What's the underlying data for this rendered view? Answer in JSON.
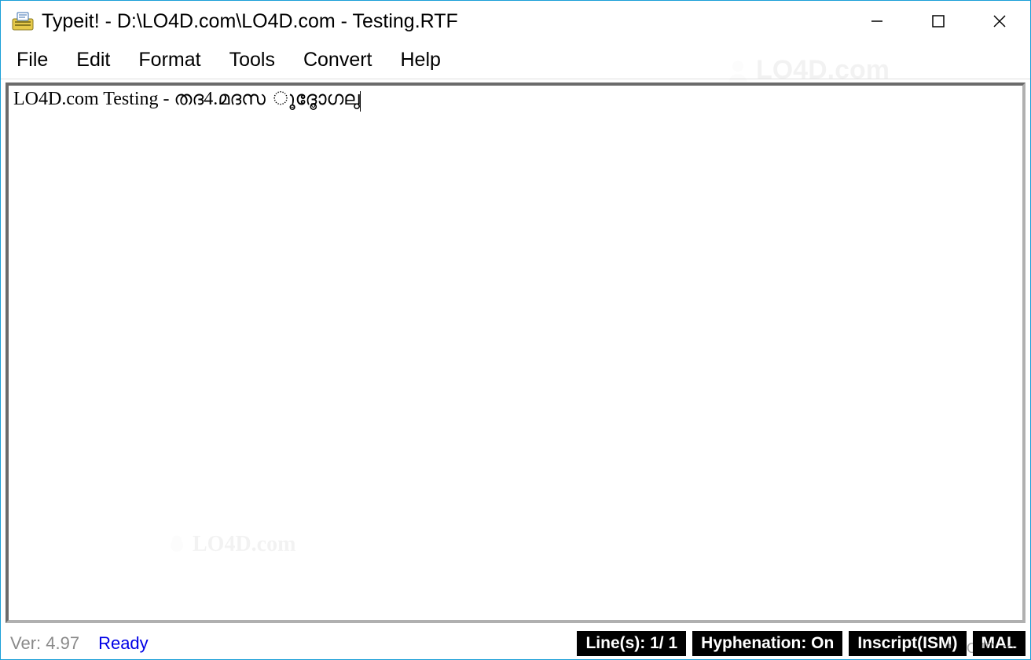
{
  "window": {
    "title": "Typeit! - D:\\LO4D.com\\LO4D.com - Testing.RTF"
  },
  "menu": {
    "items": [
      "File",
      "Edit",
      "Format",
      "Tools",
      "Convert",
      "Help"
    ]
  },
  "editor": {
    "content": "LO4D.com Testing - തദ4.മദസ ൂദോൂഗലു"
  },
  "status": {
    "version_label": "Ver: 4.97",
    "ready_label": "Ready",
    "lines_label": "Line(s):  1/ 1",
    "hyphenation_label": "Hyphenation: On",
    "script_label": "Inscript(ISM)",
    "lang_label": "MAL"
  },
  "watermark": {
    "text": "LO4D.com"
  }
}
